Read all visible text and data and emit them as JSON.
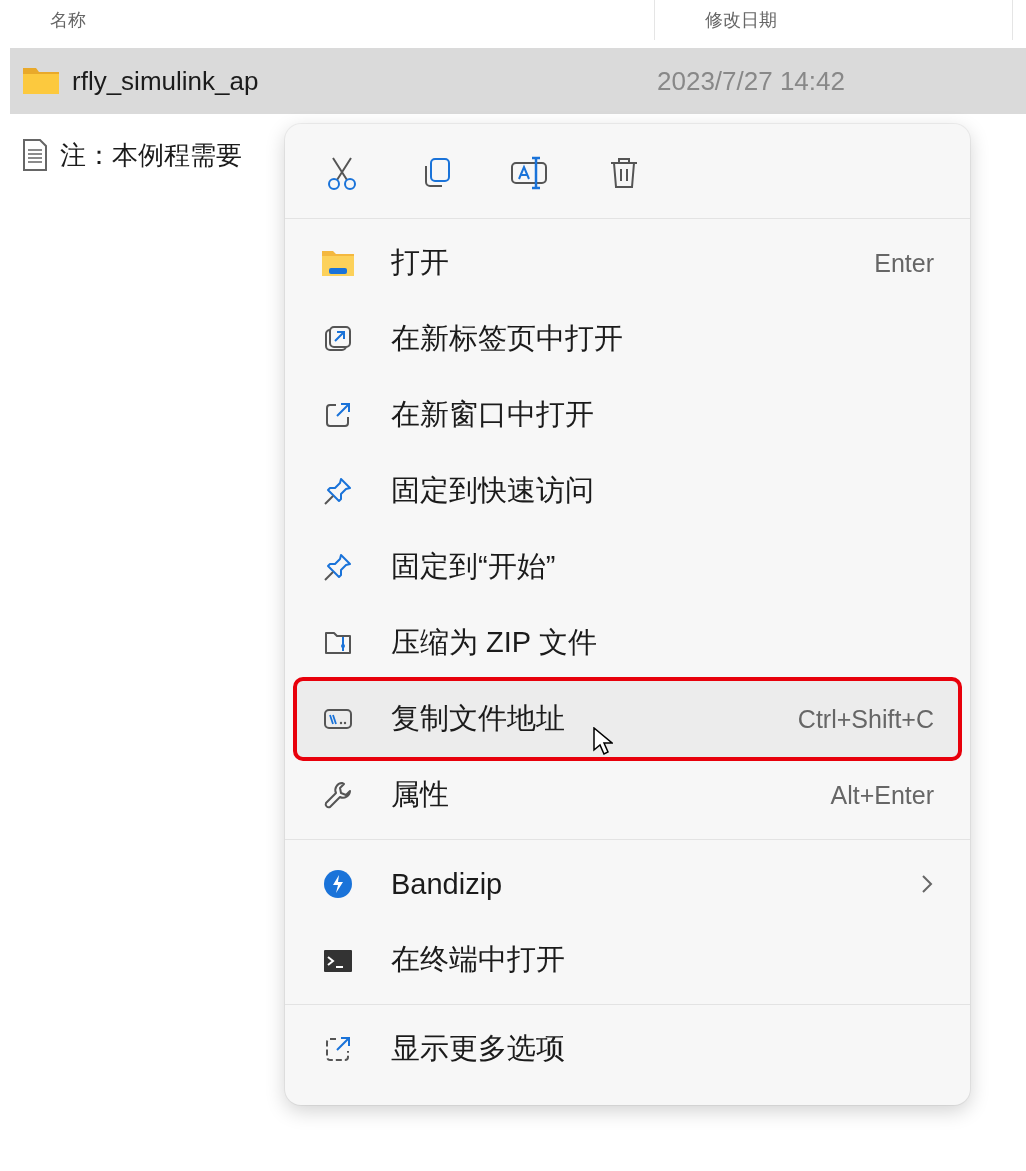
{
  "columns": [
    {
      "label": "名称"
    },
    {
      "label": "修改日期"
    }
  ],
  "files": [
    {
      "kind": "folder",
      "name": "rfly_simulink_ap",
      "date": "2023/7/27 14:42",
      "selected": true
    },
    {
      "kind": "document",
      "name": "注：本例程需要",
      "selected": false
    }
  ],
  "context_menu": {
    "groups": [
      [
        {
          "label": "打开",
          "shortcut": "Enter",
          "submenu": false,
          "highlighted": false
        },
        {
          "label": "在新标签页中打开",
          "submenu": false,
          "highlighted": false
        },
        {
          "label": "在新窗口中打开",
          "submenu": false,
          "highlighted": false
        },
        {
          "label": "固定到快速访问",
          "submenu": false,
          "highlighted": false
        },
        {
          "label": "固定到“开始”",
          "submenu": false,
          "highlighted": false
        },
        {
          "label": "压缩为 ZIP 文件",
          "submenu": false,
          "highlighted": false
        },
        {
          "label": "复制文件地址",
          "shortcut": "Ctrl+Shift+C",
          "submenu": false,
          "highlighted": true
        },
        {
          "label": "属性",
          "shortcut": "Alt+Enter",
          "submenu": false,
          "highlighted": false
        }
      ],
      [
        {
          "label": "Bandizip",
          "submenu": true,
          "highlighted": false
        },
        {
          "label": "在终端中打开",
          "submenu": false,
          "highlighted": false
        }
      ],
      [
        {
          "label": "显示更多选项",
          "submenu": false,
          "highlighted": false
        }
      ]
    ]
  }
}
